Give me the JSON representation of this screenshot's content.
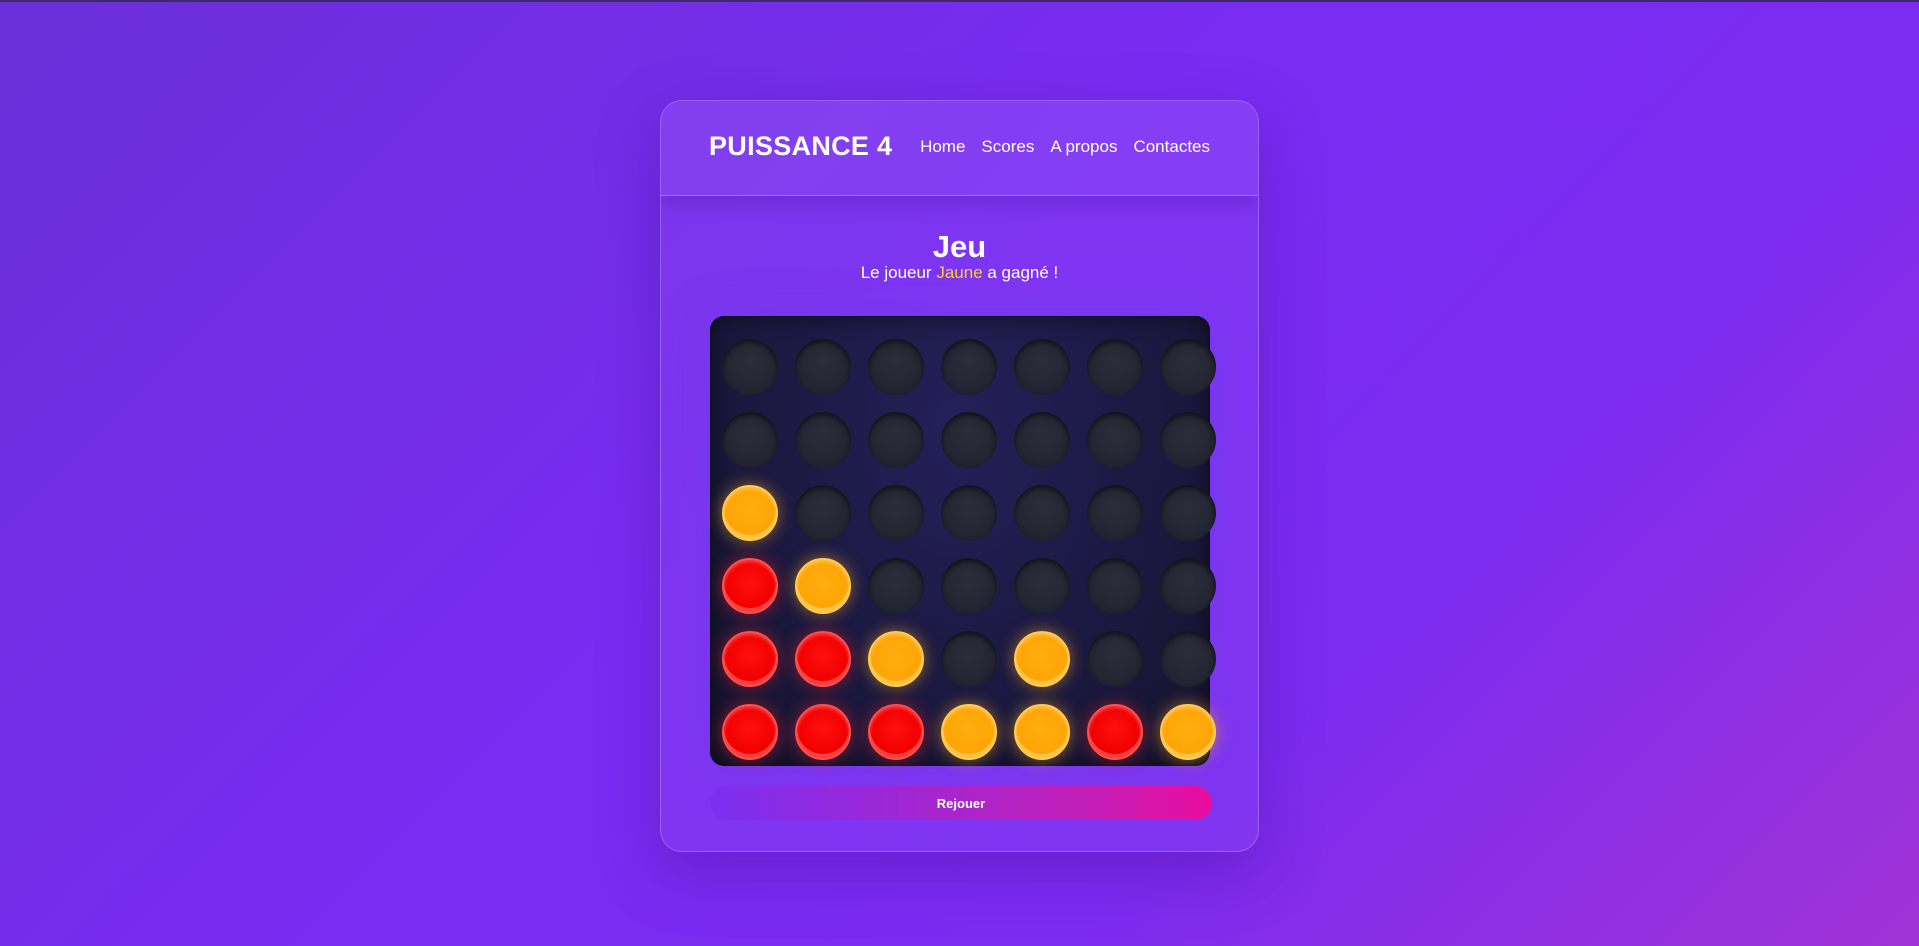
{
  "header": {
    "brand": "PUISSANCE 4",
    "nav": [
      "Home",
      "Scores",
      "A propos",
      "Contactes"
    ]
  },
  "game": {
    "title": "Jeu",
    "status_prefix": "Le joueur ",
    "winner": "Jaune",
    "status_suffix": " a gagné !",
    "replay_label": "Rejouer",
    "rows": 6,
    "cols": 7,
    "grid": [
      [
        "empty",
        "empty",
        "empty",
        "empty",
        "empty",
        "empty",
        "empty"
      ],
      [
        "empty",
        "empty",
        "empty",
        "empty",
        "empty",
        "empty",
        "empty"
      ],
      [
        "yellow",
        "empty",
        "empty",
        "empty",
        "empty",
        "empty",
        "empty"
      ],
      [
        "red",
        "yellow",
        "empty",
        "empty",
        "empty",
        "empty",
        "empty"
      ],
      [
        "red",
        "red",
        "yellow",
        "empty",
        "yellow",
        "empty",
        "empty"
      ],
      [
        "red",
        "red",
        "red",
        "yellow",
        "yellow",
        "red",
        "yellow"
      ]
    ]
  },
  "colors": {
    "yellow": "#ffa506",
    "red": "#f20000",
    "winner_text": "#ffd21f"
  }
}
